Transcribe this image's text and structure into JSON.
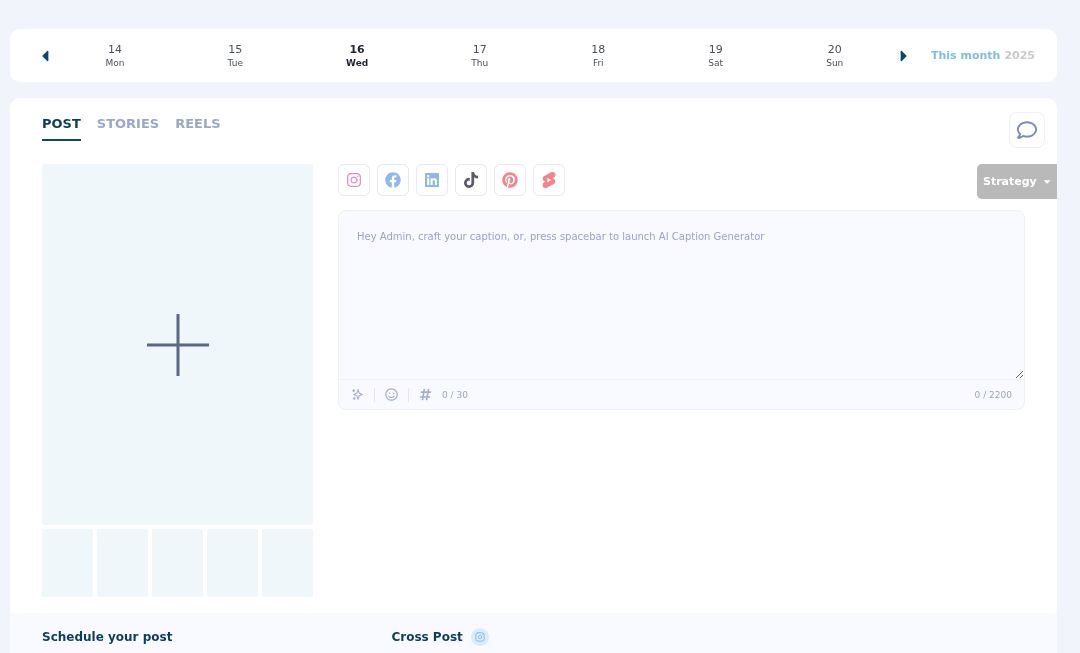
{
  "week_bar": {
    "days": [
      {
        "number": "14",
        "weekday": "Mon",
        "selected": false
      },
      {
        "number": "15",
        "weekday": "Tue",
        "selected": false
      },
      {
        "number": "16",
        "weekday": "Wed",
        "selected": true
      },
      {
        "number": "17",
        "weekday": "Thu",
        "selected": false
      },
      {
        "number": "18",
        "weekday": "Fri",
        "selected": false
      },
      {
        "number": "19",
        "weekday": "Sat",
        "selected": false
      },
      {
        "number": "20",
        "weekday": "Sun",
        "selected": false
      }
    ],
    "period": "This month",
    "year": "2025"
  },
  "tabs": [
    {
      "label": "POST",
      "selected": true
    },
    {
      "label": "STORIES",
      "selected": false
    },
    {
      "label": "REELS",
      "selected": false
    }
  ],
  "platforms": [
    {
      "kind": "instagram"
    },
    {
      "kind": "facebook"
    },
    {
      "kind": "linkedin"
    },
    {
      "kind": "tiktok"
    },
    {
      "kind": "pinterest"
    },
    {
      "kind": "shorts"
    }
  ],
  "strategy_button": "Strategy",
  "caption": {
    "placeholder": "Hey Admin, craft your caption, or, press spacebar to launch AI Caption Generator",
    "hashtag_count": "0 / 30",
    "char_count": "0 / 2200"
  },
  "thumbnails": [
    {
      "kind": "empty"
    },
    {
      "kind": "empty"
    },
    {
      "kind": "empty"
    },
    {
      "kind": "empty"
    },
    {
      "kind": "empty"
    }
  ],
  "bottom": {
    "schedule_title": "Schedule your post",
    "cross_post_title": "Cross Post"
  }
}
